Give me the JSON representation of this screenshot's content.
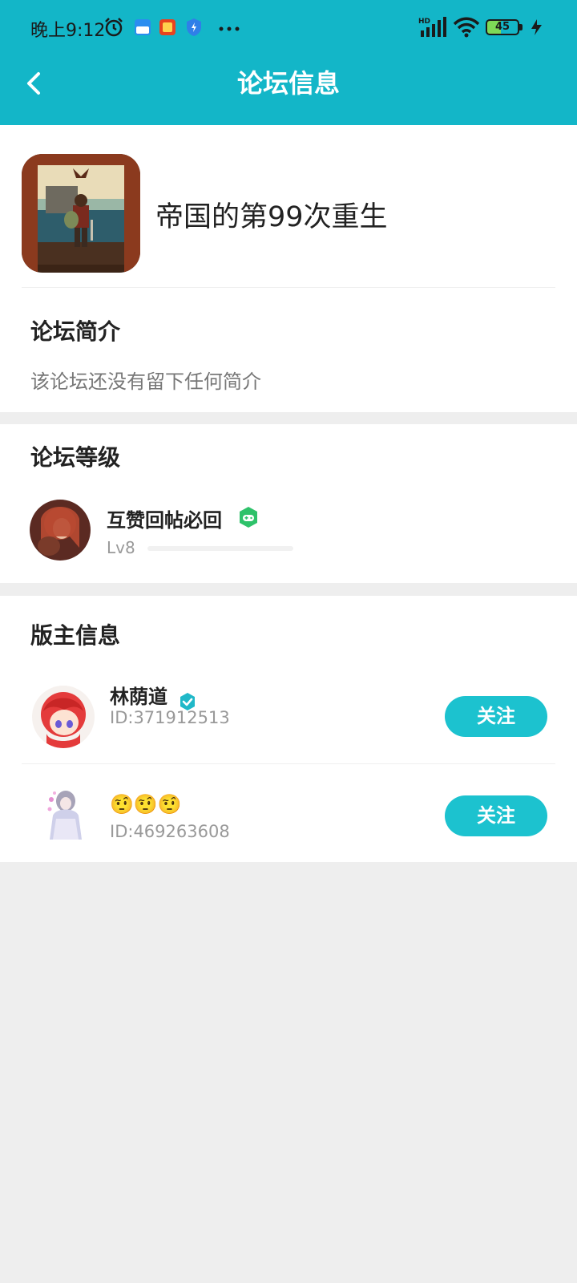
{
  "status_bar": {
    "time": "晚上9:12",
    "battery": "45",
    "icons": [
      "alarm-icon",
      "calendar-app-icon",
      "taobao-app-icon",
      "shield-app-icon",
      "more-dots-icon",
      "hd-signal-icon",
      "wifi-icon",
      "battery-icon",
      "charging-icon"
    ]
  },
  "header": {
    "title": "论坛信息",
    "back_icon": "back-chevron-icon"
  },
  "forum": {
    "name": "帝国的第99次重生"
  },
  "intro": {
    "title": "论坛简介",
    "text": "该论坛还没有留下任何简介"
  },
  "level": {
    "title": "论坛等级",
    "user_name": "互赞回帖必回",
    "level_label": "Lv8",
    "progress": 0.0,
    "badge_icon": "game-controller-badge-icon"
  },
  "moderators": {
    "title": "版主信息",
    "items": [
      {
        "name": "林荫道",
        "id": "ID:371912513",
        "follow_label": "关注",
        "verified": true
      },
      {
        "name": "🤨🤨🤨",
        "id": "ID:469263608",
        "follow_label": "关注",
        "verified": false
      }
    ]
  },
  "colors": {
    "accent": "#13b6c8",
    "button": "#1cc2cf",
    "badge_green": "#2ec26a"
  }
}
